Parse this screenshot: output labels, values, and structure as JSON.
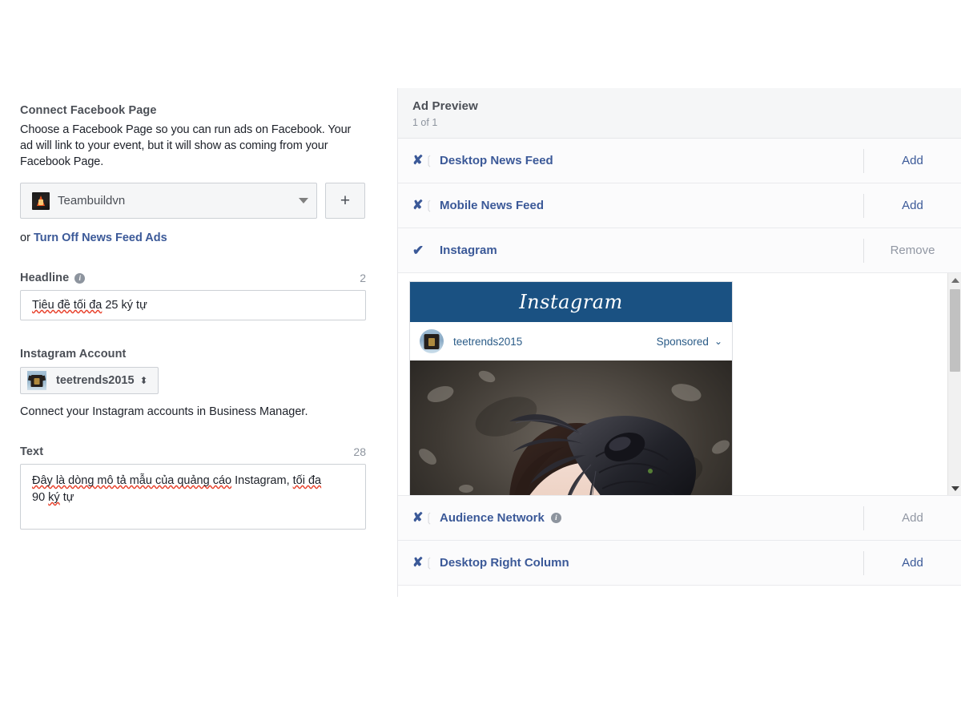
{
  "left": {
    "connect_page": {
      "label": "Connect Facebook Page",
      "description": "Choose a Facebook Page so you can run ads on Facebook. Your ad will link to your event, but it will show as coming from your Facebook Page.",
      "selected_page": "Teambuildvn",
      "add_button_label": "+",
      "or_prefix": "or",
      "turn_off_link": "Turn Off News Feed Ads"
    },
    "headline": {
      "label": "Headline",
      "info_icon": "info-icon",
      "counter": "2",
      "value": "Tiêu đề tối đa 25 ký tự",
      "spell_part": "Tiêu đề tối đa",
      "plain_part": " 25 ký tự"
    },
    "instagram_account": {
      "label": "Instagram Account",
      "selected": "teetrends2015",
      "stepper_icon": "⬍",
      "note": "Connect your Instagram accounts in Business Manager."
    },
    "text": {
      "label": "Text",
      "counter": "28",
      "value": "Đây là dòng mô tả mẫu của quảng cáo Instagram, tối đa 90 ký tự",
      "spell_part_1": "Đây là dòng mô tả mẫu của quảng cáo",
      "plain_part_1": " Instagram, ",
      "spell_part_2": "tối đa",
      "line2_plain": "90 ",
      "line2_spell": "ký",
      "line2_tail": " tự"
    }
  },
  "preview": {
    "title": "Ad Preview",
    "subtitle": "1 of 1",
    "placements": [
      {
        "name": "Desktop News Feed",
        "marker": "x-mark-icon",
        "selected": false,
        "action": "Add",
        "action_muted": false,
        "has_info": false
      },
      {
        "name": "Mobile News Feed",
        "marker": "x-mark-icon",
        "selected": false,
        "action": "Add",
        "action_muted": false,
        "has_info": false
      },
      {
        "name": "Instagram",
        "marker": "check-icon",
        "selected": true,
        "action": "Remove",
        "action_muted": true,
        "has_info": false
      },
      {
        "name": "Audience Network",
        "marker": "x-mark-icon",
        "selected": false,
        "action": "Add",
        "action_muted": true,
        "has_info": true
      },
      {
        "name": "Desktop Right Column",
        "marker": "x-mark-icon",
        "selected": false,
        "action": "Add",
        "action_muted": false,
        "has_info": false
      }
    ],
    "instagram_card": {
      "wordmark": "Instagram",
      "username": "teetrends2015",
      "sponsored_label": "Sponsored",
      "chevron_icon": "chevron-down-icon",
      "photo_alt": "woman-with-dark-feathered-headpiece"
    },
    "scrollbar": {
      "up_icon": "scroll-up-arrow-icon",
      "down_icon": "scroll-down-arrow-icon"
    }
  },
  "colors": {
    "fb_blue": "#3b5998",
    "muted": "#8d949e",
    "ig_header": "#1a5182",
    "panel_bg": "#f5f6f7"
  }
}
